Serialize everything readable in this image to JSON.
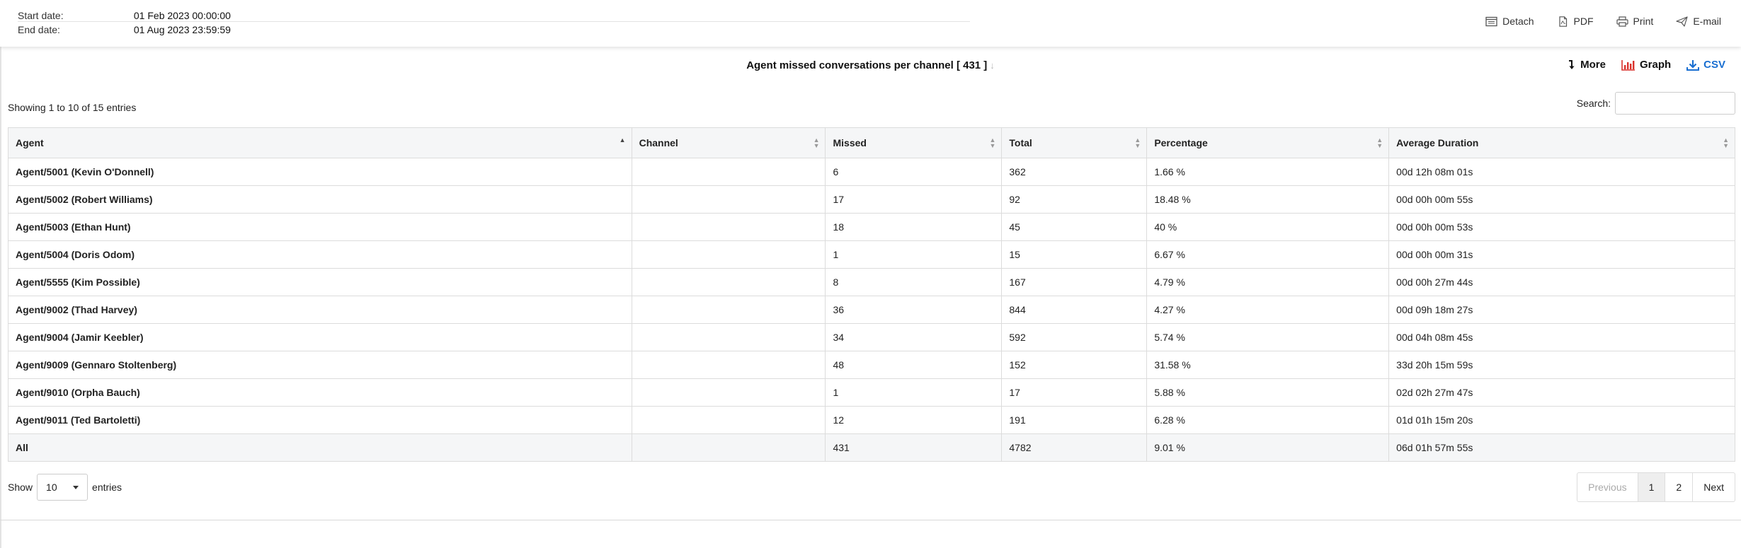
{
  "header": {
    "start_label": "Start date:",
    "start_value": "01 Feb 2023 00:00:00",
    "end_label": "End date:",
    "end_value": "01 Aug 2023 23:59:59",
    "actions": {
      "detach": "Detach",
      "pdf": "PDF",
      "print": "Print",
      "email": "E-mail"
    }
  },
  "report": {
    "title": "Agent missed conversations per channel [ 431 ]",
    "more": "More",
    "graph": "Graph",
    "csv": "CSV"
  },
  "table_info": "Showing 1 to 10 of 15 entries",
  "search": {
    "label": "Search:",
    "value": "",
    "placeholder": ""
  },
  "table": {
    "columns": [
      "Agent",
      "Channel",
      "Missed",
      "Total",
      "Percentage",
      "Average Duration"
    ],
    "rows": [
      {
        "agent": "Agent/5001 (Kevin O'Donnell)",
        "channel": "",
        "missed": "6",
        "total": "362",
        "percentage": "1.66 %",
        "avg": "00d 12h 08m 01s"
      },
      {
        "agent": "Agent/5002 (Robert Williams)",
        "channel": "",
        "missed": "17",
        "total": "92",
        "percentage": "18.48 %",
        "avg": "00d 00h 00m 55s"
      },
      {
        "agent": "Agent/5003 (Ethan Hunt)",
        "channel": "",
        "missed": "18",
        "total": "45",
        "percentage": "40 %",
        "avg": "00d 00h 00m 53s"
      },
      {
        "agent": "Agent/5004 (Doris Odom)",
        "channel": "",
        "missed": "1",
        "total": "15",
        "percentage": "6.67 %",
        "avg": "00d 00h 00m 31s"
      },
      {
        "agent": "Agent/5555 (Kim Possible)",
        "channel": "",
        "missed": "8",
        "total": "167",
        "percentage": "4.79 %",
        "avg": "00d 00h 27m 44s"
      },
      {
        "agent": "Agent/9002 (Thad Harvey)",
        "channel": "",
        "missed": "36",
        "total": "844",
        "percentage": "4.27 %",
        "avg": "00d 09h 18m 27s"
      },
      {
        "agent": "Agent/9004 (Jamir Keebler)",
        "channel": "",
        "missed": "34",
        "total": "592",
        "percentage": "5.74 %",
        "avg": "00d 04h 08m 45s"
      },
      {
        "agent": "Agent/9009 (Gennaro Stoltenberg)",
        "channel": "",
        "missed": "48",
        "total": "152",
        "percentage": "31.58 %",
        "avg": "33d 20h 15m 59s"
      },
      {
        "agent": "Agent/9010 (Orpha Bauch)",
        "channel": "",
        "missed": "1",
        "total": "17",
        "percentage": "5.88 %",
        "avg": "02d 02h 27m 47s"
      },
      {
        "agent": "Agent/9011 (Ted Bartoletti)",
        "channel": "",
        "missed": "12",
        "total": "191",
        "percentage": "6.28 %",
        "avg": "01d 01h 15m 20s"
      }
    ],
    "footer": {
      "agent": "All",
      "channel": "",
      "missed": "431",
      "total": "4782",
      "percentage": "9.01 %",
      "avg": "06d 01h 57m 55s"
    }
  },
  "length": {
    "show_label": "Show",
    "value": "10",
    "entries_label": "entries"
  },
  "pagination": {
    "previous": "Previous",
    "pages": [
      "1",
      "2"
    ],
    "next": "Next"
  },
  "colors": {
    "csv": "#1a6fd1",
    "graph_icon": "#d9312b"
  }
}
